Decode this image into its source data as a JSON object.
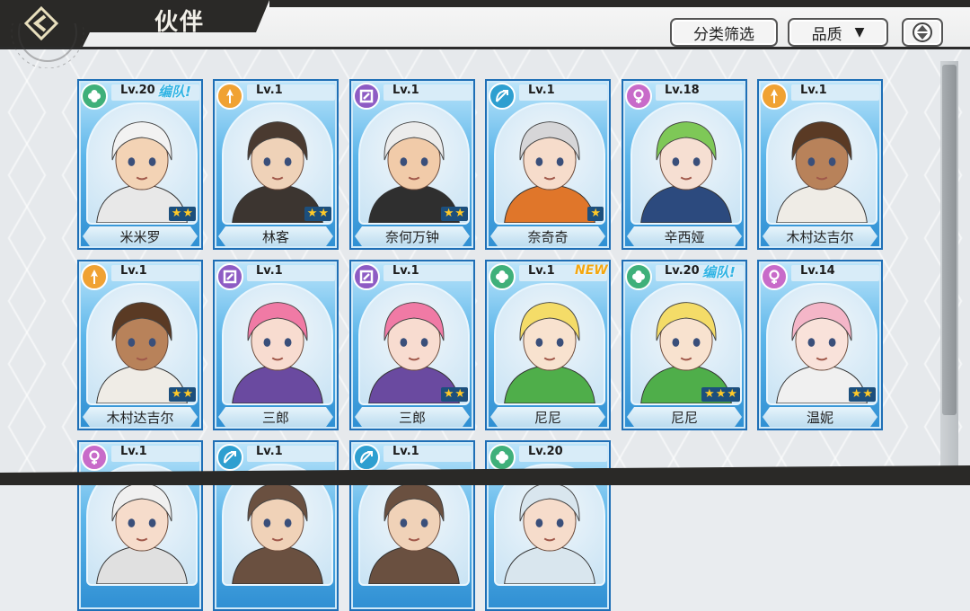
{
  "header": {
    "title": "伙伴",
    "filter_label": "分类筛选",
    "quality_label": "品质",
    "quality_caret": "▼"
  },
  "colors": {
    "wind": "#3fb07a",
    "fire": "#f0a233",
    "thunder": "#8e5cc4",
    "water": "#2e9fd0",
    "spirit": "#c86bc9"
  },
  "cards": [
    {
      "name": "米米罗",
      "level": "Lv.20",
      "badge": "编队!",
      "element": "wind",
      "stars": 2,
      "hair": "#f2f2f2",
      "skin": "#f3d3b5",
      "outfit": "#e8e8e8"
    },
    {
      "name": "林客",
      "level": "Lv.1",
      "badge": "",
      "element": "fire",
      "stars": 2,
      "hair": "#4a3a30",
      "skin": "#efd2b8",
      "outfit": "#3c3530"
    },
    {
      "name": "奈何万钟",
      "level": "Lv.1",
      "badge": "",
      "element": "thunder",
      "stars": 2,
      "hair": "#ececec",
      "skin": "#f1cba9",
      "outfit": "#2f2f2f"
    },
    {
      "name": "奈奇奇",
      "level": "Lv.1",
      "badge": "",
      "element": "water",
      "stars": 1,
      "hair": "#d6d6d8",
      "skin": "#f6dccb",
      "outfit": "#e0762a"
    },
    {
      "name": "辛西娅",
      "level": "Lv.18",
      "badge": "",
      "element": "spirit",
      "stars": 0,
      "hair": "#7ec857",
      "skin": "#f6dfd2",
      "outfit": "#2c4a7e"
    },
    {
      "name": "木村达吉尔",
      "level": "Lv.1",
      "badge": "",
      "element": "fire",
      "stars": 0,
      "hair": "#5a3a24",
      "skin": "#b8825a",
      "outfit": "#efece6"
    },
    {
      "name": "木村达吉尔",
      "level": "Lv.1",
      "badge": "",
      "element": "fire",
      "stars": 2,
      "hair": "#5a3a24",
      "skin": "#b8825a",
      "outfit": "#efece6"
    },
    {
      "name": "三郎",
      "level": "Lv.1",
      "badge": "",
      "element": "thunder",
      "stars": 0,
      "hair": "#f07aa5",
      "skin": "#f8dcd0",
      "outfit": "#6a4aa0"
    },
    {
      "name": "三郎",
      "level": "Lv.1",
      "badge": "",
      "element": "thunder",
      "stars": 2,
      "hair": "#f07aa5",
      "skin": "#f8dcd0",
      "outfit": "#6a4aa0"
    },
    {
      "name": "尼尼",
      "level": "Lv.1",
      "badge": "NEW",
      "element": "wind",
      "stars": 0,
      "hair": "#f4dc68",
      "skin": "#f8e2cf",
      "outfit": "#4fae4a"
    },
    {
      "name": "尼尼",
      "level": "Lv.20",
      "badge": "编队!",
      "element": "wind",
      "stars": 3,
      "hair": "#f4dc68",
      "skin": "#f8e2cf",
      "outfit": "#4fae4a"
    },
    {
      "name": "温妮",
      "level": "Lv.14",
      "badge": "",
      "element": "spirit",
      "stars": 2,
      "hair": "#f4b6c8",
      "skin": "#f9e2da",
      "outfit": "#f0f0f0"
    },
    {
      "name": "",
      "level": "Lv.1",
      "badge": "",
      "element": "spirit",
      "stars": 0,
      "hair": "#f0f0f0",
      "skin": "#f6dccb",
      "outfit": "#e0e0e0"
    },
    {
      "name": "",
      "level": "Lv.1",
      "badge": "",
      "element": "water",
      "stars": 0,
      "hair": "#6a5040",
      "skin": "#f0d2b8",
      "outfit": "#6a5040"
    },
    {
      "name": "",
      "level": "Lv.1",
      "badge": "",
      "element": "water",
      "stars": 0,
      "hair": "#6a5040",
      "skin": "#f0d2b8",
      "outfit": "#6a5040"
    },
    {
      "name": "",
      "level": "Lv.20",
      "badge": "",
      "element": "wind",
      "stars": 0,
      "hair": "#d9e6ee",
      "skin": "#f6dccb",
      "outfit": "#d9e6ee"
    }
  ]
}
